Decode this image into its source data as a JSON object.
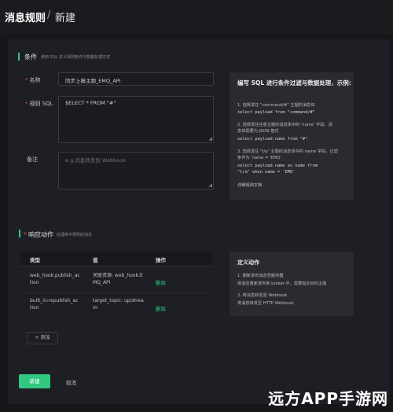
{
  "header": {
    "title": "消息规则",
    "separator": "/",
    "subtitle": "新建"
  },
  "conditions": {
    "title": "条件",
    "subtitle": "使用 SQL 定义规则条件与数据处理方式",
    "name_label": "名称",
    "name_value": "同步上报主题_EMQ_API",
    "sql_label": "规则 SQL",
    "sql_value": "$ELECT * FROM \"#\"",
    "remark_label": "备注",
    "remark_placeholder": "e.g.消息转发到 Webhook"
  },
  "sql_help": {
    "title": "编写 SQL 进行条件过滤与数据处理，示例:",
    "l1": "1. 选择发往 \"command/#\" 主题的消息体",
    "c1": "select payload from \"command/#\"",
    "l2": "2. 选择发往任意主题的消息体中的 'name' 字段，消",
    "l2b": "息体需要为 JSON 格式",
    "c2": "select payload.name from \"#\"",
    "l3": "3. 选择发往 \"t/a\" 主题的消息体中的 name 字段，过滤",
    "l3b": "条件为 'name = 'EMQ'",
    "c3a": "select payload.name as name from",
    "c3b": "\"t/a\" when name = 'EMQ'",
    "link": "详细规则文档"
  },
  "actions": {
    "title": "响应动作",
    "subtitle": "处理命中规则的消息",
    "col_type": "类型",
    "col_value": "值",
    "col_op": "操作",
    "rows": [
      {
        "type1": "web_hook:publish_ac",
        "type2": "tion",
        "value1": "关联资源: web_hook:E",
        "value2": "MQ_API",
        "op": "删除"
      },
      {
        "type1": "built_in:republish_ac",
        "type2": "tion",
        "value1": "target_topic: up/strea",
        "value2": "m",
        "op": "删除"
      }
    ],
    "add": "+ 添加"
  },
  "action_help": {
    "title": "定义动作",
    "l1": "1. 删新发布消息至服务器",
    "l2": "将消息重新发布到 broker 中，需要指定目标主题",
    "l3": "2. 将消息转发至 Webhook",
    "l4": "将消息转发至 HTTP Webhook"
  },
  "footer": {
    "submit": "新建",
    "cancel": "取消"
  },
  "watermark": "远方APP手游网",
  "colors": {
    "accent": "#31c880",
    "bg": "#16171b",
    "panel": "#1e1f24"
  }
}
